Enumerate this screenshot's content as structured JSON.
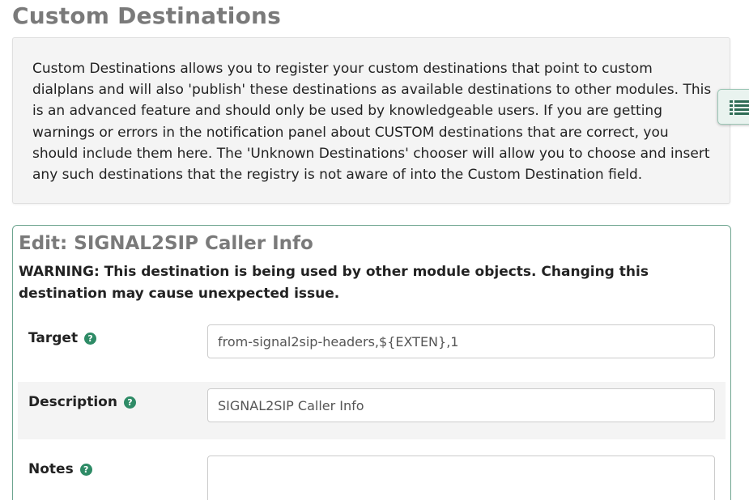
{
  "page": {
    "title": "Custom Destinations",
    "info_text": "Custom Destinations allows you to register your custom destinations that point to custom dialplans and will also 'publish' these destinations as available destinations to other modules. This is an advanced feature and should only be used by knowledgeable users. If you are getting warnings or errors in the notification panel about CUSTOM destinations that are correct, you should include them here. The 'Unknown Destinations' chooser will allow you to choose and insert any such destinations that the registry is not aware of into the Custom Destination field."
  },
  "side_toggle": {
    "icon": "list-icon"
  },
  "edit": {
    "title": "Edit: SIGNAL2SIP Caller Info",
    "warning": "WARNING: This destination is being used by other module objects. Changing this destination may cause unexpected issue."
  },
  "form": {
    "target": {
      "label": "Target",
      "value": "from-signal2sip-headers,${EXTEN},1",
      "help_icon": "question-circle-icon"
    },
    "description": {
      "label": "Description",
      "value": "SIGNAL2SIP Caller Info",
      "help_icon": "question-circle-icon"
    },
    "notes": {
      "label": "Notes",
      "value": "",
      "help_icon": "question-circle-icon"
    }
  },
  "colors": {
    "accent_green": "#2e8b66",
    "panel_border": "#6ea590",
    "title_gray": "#7a7a7a",
    "box_background": "#f4f4f4"
  }
}
